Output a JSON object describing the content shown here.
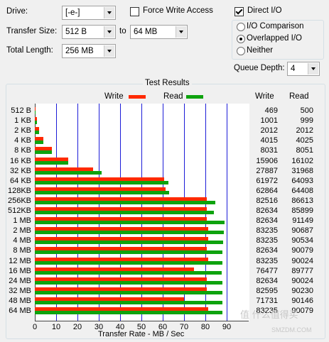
{
  "drive": {
    "label": "Drive:",
    "value": "[-e-]"
  },
  "force_write": {
    "label": "Force Write Access",
    "checked": false
  },
  "direct_io": {
    "label": "Direct I/O",
    "checked": true
  },
  "transfer_size": {
    "label": "Transfer Size:",
    "from": "512 B",
    "to_label": "to",
    "to": "64 MB"
  },
  "total_length": {
    "label": "Total Length:",
    "value": "256 MB"
  },
  "io_mode": {
    "options": [
      "I/O Comparison",
      "Overlapped I/O",
      "Neither"
    ],
    "selected": "Overlapped I/O"
  },
  "queue_depth": {
    "label": "Queue Depth:",
    "value": "4"
  },
  "results": {
    "title": "Test Results",
    "legend_write": "Write",
    "legend_read": "Read",
    "col_write": "Write",
    "col_read": "Read",
    "xlabel": "Transfer Rate - MB / Sec",
    "colors": {
      "write": "#ff2a00",
      "read": "#0ea30e",
      "grid": "#1c1cd8"
    }
  },
  "watermark": {
    "main": "值 什么值得买",
    "sub": "SMZDM.COM"
  },
  "chart_data": {
    "type": "bar",
    "orientation": "horizontal",
    "xlabel": "Transfer Rate - MB / Sec",
    "xlim": [
      0,
      100
    ],
    "xticks": [
      "0",
      "10",
      "20",
      "30",
      "40",
      "50",
      "60",
      "70",
      "80",
      "90"
    ],
    "categories": [
      "512 B",
      "1 KB",
      "2 KB",
      "4 KB",
      "8 KB",
      "16 KB",
      "32 KB",
      "64 KB",
      "128KB",
      "256KB",
      "512KB",
      "1 MB",
      "2 MB",
      "4 MB",
      "8 MB",
      "12 MB",
      "16 MB",
      "24 MB",
      "32 MB",
      "48 MB",
      "64 MB"
    ],
    "series": [
      {
        "name": "Write",
        "values": [
          0.46,
          0.98,
          1.96,
          3.92,
          7.84,
          15.53,
          27.23,
          60.52,
          61.39,
          80.58,
          80.67,
          80.67,
          81.28,
          81.28,
          80.67,
          81.28,
          74.68,
          80.67,
          80.66,
          70.05,
          81.28
        ],
        "labels": [
          "469",
          "1001",
          "2012",
          "4015",
          "8031",
          "15906",
          "27887",
          "61972",
          "62864",
          "82516",
          "82634",
          "82634",
          "83235",
          "83235",
          "82634",
          "83235",
          "76477",
          "82634",
          "82595",
          "71731",
          "83235"
        ]
      },
      {
        "name": "Read",
        "values": [
          0.49,
          0.98,
          1.96,
          3.93,
          7.86,
          15.72,
          31.22,
          62.59,
          62.88,
          84.58,
          83.88,
          89.01,
          88.56,
          88.41,
          87.97,
          87.91,
          87.67,
          87.91,
          88.11,
          88.03,
          87.97
        ],
        "labels": [
          "500",
          "999",
          "2012",
          "4025",
          "8051",
          "16102",
          "31968",
          "64093",
          "64408",
          "86613",
          "85899",
          "91149",
          "90687",
          "90534",
          "90079",
          "90024",
          "89777",
          "90024",
          "90230",
          "90146",
          "90079"
        ]
      }
    ]
  }
}
